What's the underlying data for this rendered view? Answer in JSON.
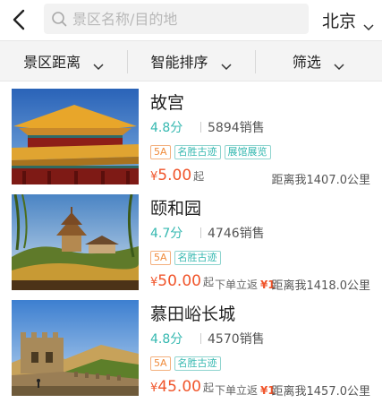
{
  "search": {
    "placeholder": "景区名称/目的地"
  },
  "city": "北京",
  "filters": [
    "景区距离",
    "智能排序",
    "筛选"
  ],
  "items": [
    {
      "name": "故宫",
      "rating": "4.8分",
      "sales": "5894销售",
      "tags": [
        "5A",
        "名胜古迹",
        "展馆展览"
      ],
      "price_currency": "¥",
      "price": "5.00",
      "price_suffix": "起",
      "cashback_label": "",
      "cashback_amount": "",
      "distance": "距离我1407.0公里",
      "image": "forbidden-city-photo"
    },
    {
      "name": "颐和园",
      "rating": "4.7分",
      "sales": "4746销售",
      "tags": [
        "5A",
        "名胜古迹"
      ],
      "price_currency": "¥",
      "price": "50.00",
      "price_suffix": "起",
      "cashback_label": "下单立返",
      "cashback_amount": "¥1",
      "distance": "距离我1418.0公里",
      "image": "summer-palace-photo"
    },
    {
      "name": "慕田峪长城",
      "rating": "4.8分",
      "sales": "4570销售",
      "tags": [
        "5A",
        "名胜古迹"
      ],
      "price_currency": "¥",
      "price": "45.00",
      "price_suffix": "起",
      "cashback_label": "下单立返",
      "cashback_amount": "¥1",
      "distance": "距离我1457.0公里",
      "image": "great-wall-photo"
    }
  ],
  "colors": {
    "accent_teal": "#35b8b0",
    "price_red": "#f0552b",
    "level_orange": "#f08c3c"
  }
}
